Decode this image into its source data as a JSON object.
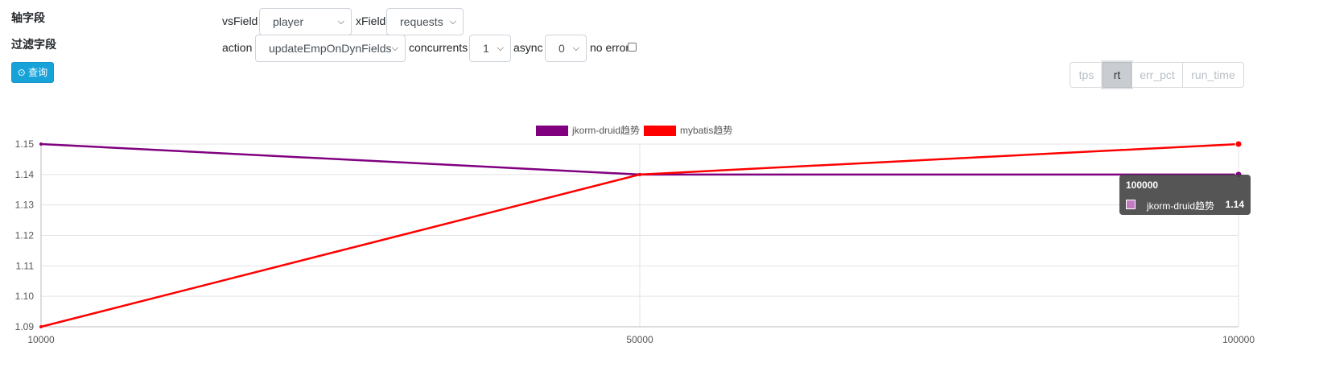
{
  "filters": {
    "axis_label": "轴字段",
    "filter_label": "过滤字段",
    "query_button": "⊙ 查询",
    "vsfield_label": "vsField",
    "vsfield_value": "player",
    "xfield_label": "xField",
    "xfield_value": "requests",
    "action_label": "action",
    "action_value": "updateEmpOnDynFields",
    "concurrents_label": "concurrents",
    "concurrents_value": "1",
    "async_label": "async",
    "async_value": "0",
    "noerror_label": "no error"
  },
  "metric_tabs": [
    {
      "label": "tps",
      "active": false
    },
    {
      "label": "rt",
      "active": true
    },
    {
      "label": "err_pct",
      "active": false
    },
    {
      "label": "run_time",
      "active": false
    }
  ],
  "tooltip": {
    "title": "100000",
    "series_name": "jkorm-druid趋势",
    "value": "1.14",
    "swatch_color": "#c07cc0"
  },
  "chart_data": {
    "type": "line",
    "x": [
      10000,
      50000,
      100000
    ],
    "x_ticks": [
      "10000",
      "50000",
      "100000"
    ],
    "ylim": [
      1.09,
      1.15
    ],
    "y_ticks": [
      "1.09",
      "1.10",
      "1.11",
      "1.12",
      "1.13",
      "1.14",
      "1.15"
    ],
    "grid": true,
    "legend_position": "top",
    "series": [
      {
        "name": "jkorm-druid趋势",
        "color": "#800080",
        "values": [
          1.15,
          1.14,
          1.14
        ]
      },
      {
        "name": "mybatis趋势",
        "color": "#ff0000",
        "values": [
          1.09,
          1.14,
          1.15
        ]
      }
    ]
  }
}
